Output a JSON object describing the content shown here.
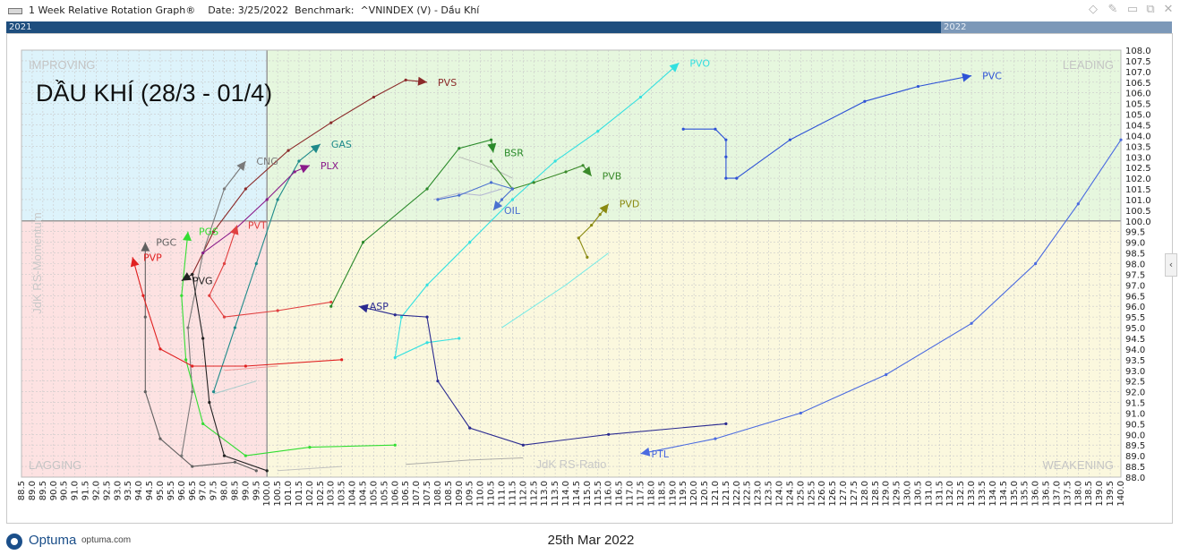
{
  "window": {
    "title": "1 Week Relative Rotation Graph®    Date: 3/25/2022  Benchmark:  ^VNINDEX (V) - Dầu Khí",
    "controls": [
      "◇",
      "✎",
      "▭",
      "⧉",
      "✕"
    ]
  },
  "timeline": {
    "left_label": "2021",
    "right_label": "2022"
  },
  "footer": {
    "logo_text": "Optuma",
    "logo_url": "optuma.com",
    "date": "25th Mar 2022"
  },
  "colors": {
    "improving": "#ddf3fb",
    "leading": "#e6f7de",
    "lagging": "#fde2e2",
    "weakening": "#fbf8de",
    "grid": "#c9c9c9",
    "axis": "#9a9a9a"
  },
  "chart_data": {
    "type": "scatter",
    "title": "DẦU KHÍ (28/3 - 01/4)",
    "xlabel": "JdK RS-Ratio",
    "ylabel": "JdK RS-Momentum",
    "xlim": [
      88.5,
      140.0
    ],
    "ylim": [
      88.0,
      108.0
    ],
    "x_ticks": [
      "88.5",
      "89.0",
      "89.5",
      "90.0",
      "90.5",
      "91.0",
      "91.5",
      "92.0",
      "92.5",
      "93.0",
      "93.5",
      "94.0",
      "94.5",
      "95.0",
      "95.5",
      "96.0",
      "96.5",
      "97.0",
      "97.5",
      "98.0",
      "98.5",
      "99.0",
      "99.5",
      "100.0",
      "100.5",
      "101.0",
      "101.5",
      "102.0",
      "102.5",
      "103.0",
      "103.5",
      "104.0",
      "104.5",
      "105.0",
      "105.5",
      "106.0",
      "106.5",
      "107.0",
      "107.5",
      "108.0",
      "108.5",
      "109.0",
      "109.5",
      "110.0",
      "110.5",
      "111.0",
      "111.5",
      "112.0",
      "112.5",
      "113.0",
      "113.5",
      "114.0",
      "114.5",
      "115.0",
      "115.5",
      "116.0",
      "116.5",
      "117.0",
      "117.5",
      "118.0",
      "118.5",
      "119.0",
      "119.5",
      "120.0",
      "120.5",
      "121.0",
      "121.5",
      "122.0",
      "122.5",
      "123.0",
      "123.5",
      "124.0",
      "124.5",
      "125.0",
      "125.5",
      "126.0",
      "126.5",
      "127.0",
      "127.5",
      "128.0",
      "128.5",
      "129.0",
      "129.5",
      "130.0",
      "130.5",
      "131.0",
      "131.5",
      "132.0",
      "132.5",
      "133.0",
      "133.5",
      "134.0",
      "134.5",
      "135.0",
      "135.5",
      "136.0",
      "136.5",
      "137.0",
      "137.5",
      "138.0",
      "138.5",
      "139.0",
      "139.5",
      "140.0"
    ],
    "y_ticks": [
      "108.0",
      "107.5",
      "107.0",
      "106.5",
      "106.0",
      "105.5",
      "105.0",
      "104.5",
      "104.0",
      "103.5",
      "103.0",
      "102.5",
      "102.0",
      "101.5",
      "101.0",
      "100.5",
      "100.0",
      "99.5",
      "99.0",
      "98.5",
      "98.0",
      "97.5",
      "97.0",
      "96.5",
      "96.0",
      "95.5",
      "95.0",
      "94.5",
      "94.0",
      "93.5",
      "93.0",
      "92.5",
      "92.0",
      "91.5",
      "91.0",
      "90.5",
      "90.0",
      "89.5",
      "89.0",
      "88.5",
      "88.0"
    ],
    "quadrants": {
      "improving": "IMPROVING",
      "leading": "LEADING",
      "lagging": "LAGGING",
      "weakening": "WEAKENING"
    },
    "grid": true,
    "series": [
      {
        "name": "PVS",
        "color": "#8b2a2a",
        "points": [
          [
            96.5,
            97.5
          ],
          [
            97.5,
            99.5
          ],
          [
            99.0,
            101.5
          ],
          [
            101.0,
            103.3
          ],
          [
            103.0,
            104.6
          ],
          [
            105.0,
            105.8
          ],
          [
            106.5,
            106.6
          ],
          [
            107.5,
            106.5
          ]
        ]
      },
      {
        "name": "PVO",
        "color": "#33e0e0",
        "points": [
          [
            109.0,
            94.5
          ],
          [
            107.5,
            94.3
          ],
          [
            106.0,
            93.6
          ],
          [
            106.3,
            95.5
          ],
          [
            107.5,
            97.0
          ],
          [
            109.5,
            99.0
          ],
          [
            111.5,
            101.0
          ],
          [
            113.5,
            102.8
          ],
          [
            115.5,
            104.2
          ],
          [
            117.5,
            105.8
          ],
          [
            119.3,
            107.4
          ]
        ]
      },
      {
        "name": "PVC",
        "color": "#2e52d6",
        "points": [
          [
            119.5,
            104.3
          ],
          [
            121.0,
            104.3
          ],
          [
            121.5,
            103.8
          ],
          [
            121.5,
            103.0
          ],
          [
            121.5,
            102.0
          ],
          [
            122.0,
            102.0
          ],
          [
            124.5,
            103.8
          ],
          [
            128.0,
            105.6
          ],
          [
            130.5,
            106.3
          ],
          [
            133.0,
            106.8
          ]
        ]
      },
      {
        "name": "GAS",
        "color": "#1e8a8a",
        "points": [
          [
            97.5,
            92.0
          ],
          [
            98.5,
            95.0
          ],
          [
            99.5,
            98.0
          ],
          [
            100.5,
            101.0
          ],
          [
            101.5,
            102.8
          ],
          [
            102.5,
            103.6
          ]
        ]
      },
      {
        "name": "BSR",
        "color": "#2a8a2a",
        "points": [
          [
            103.0,
            96.0
          ],
          [
            104.5,
            99.0
          ],
          [
            107.5,
            101.5
          ],
          [
            109.0,
            103.4
          ],
          [
            110.5,
            103.8
          ],
          [
            110.6,
            103.2
          ]
        ]
      },
      {
        "name": "CNG",
        "color": "#7a7a7a",
        "points": [
          [
            96.0,
            89.0
          ],
          [
            96.5,
            92.0
          ],
          [
            96.3,
            95.0
          ],
          [
            97.0,
            98.5
          ],
          [
            98.0,
            101.5
          ],
          [
            99.0,
            102.8
          ]
        ]
      },
      {
        "name": "PLX",
        "color": "#8a1a8a",
        "points": [
          [
            97.0,
            98.5
          ],
          [
            98.5,
            99.6
          ],
          [
            100.0,
            101.0
          ],
          [
            101.3,
            102.3
          ],
          [
            102.0,
            102.6
          ]
        ]
      },
      {
        "name": "PVB",
        "color": "#3a8a2a",
        "points": [
          [
            110.5,
            102.8
          ],
          [
            111.5,
            101.5
          ],
          [
            112.5,
            101.8
          ],
          [
            114.0,
            102.3
          ],
          [
            114.8,
            102.6
          ],
          [
            115.2,
            102.1
          ]
        ]
      },
      {
        "name": "OIL",
        "color": "#4a70d0",
        "points": [
          [
            108.0,
            101.0
          ],
          [
            109.0,
            101.2
          ],
          [
            110.5,
            101.8
          ],
          [
            111.5,
            101.5
          ],
          [
            111.0,
            101.0
          ],
          [
            110.6,
            100.5
          ]
        ]
      },
      {
        "name": "PVD",
        "color": "#8a8a10",
        "points": [
          [
            115.0,
            98.3
          ],
          [
            114.6,
            99.2
          ],
          [
            115.2,
            99.8
          ],
          [
            115.6,
            100.3
          ],
          [
            116.0,
            100.8
          ]
        ]
      },
      {
        "name": "PVT",
        "color": "#e04040",
        "points": [
          [
            103.0,
            96.2
          ],
          [
            100.5,
            95.8
          ],
          [
            98.0,
            95.5
          ],
          [
            97.3,
            96.5
          ],
          [
            98.0,
            98.0
          ],
          [
            98.6,
            99.8
          ]
        ]
      },
      {
        "name": "PGS",
        "color": "#33dd33",
        "points": [
          [
            106.0,
            89.5
          ],
          [
            102.0,
            89.4
          ],
          [
            99.0,
            89.0
          ],
          [
            97.0,
            90.5
          ],
          [
            96.2,
            93.5
          ],
          [
            96.0,
            96.5
          ],
          [
            96.3,
            99.5
          ]
        ]
      },
      {
        "name": "PGC",
        "color": "#606060",
        "points": [
          [
            99.5,
            88.3
          ],
          [
            98.5,
            88.7
          ],
          [
            96.5,
            88.5
          ],
          [
            95.0,
            89.8
          ],
          [
            94.3,
            92.0
          ],
          [
            94.3,
            95.5
          ],
          [
            94.3,
            99.0
          ]
        ]
      },
      {
        "name": "PVP",
        "color": "#e02020",
        "points": [
          [
            103.5,
            93.5
          ],
          [
            99.0,
            93.2
          ],
          [
            96.5,
            93.2
          ],
          [
            95.0,
            94.0
          ],
          [
            94.2,
            96.5
          ],
          [
            93.7,
            98.3
          ]
        ]
      },
      {
        "name": "PVG",
        "color": "#222222",
        "points": [
          [
            100.0,
            88.3
          ],
          [
            98.0,
            89.0
          ],
          [
            97.3,
            91.5
          ],
          [
            97.0,
            94.5
          ],
          [
            96.5,
            97.5
          ],
          [
            96.0,
            97.2
          ]
        ]
      },
      {
        "name": "ASP",
        "color": "#2a2a90",
        "points": [
          [
            121.5,
            90.5
          ],
          [
            116.0,
            90.0
          ],
          [
            112.0,
            89.5
          ],
          [
            109.5,
            90.3
          ],
          [
            108.0,
            92.5
          ],
          [
            107.5,
            95.5
          ],
          [
            106.0,
            95.6
          ],
          [
            104.3,
            96.0
          ]
        ]
      },
      {
        "name": "PTL",
        "color": "#4a6ae0",
        "points": [
          [
            140.0,
            103.8
          ],
          [
            138.0,
            100.8
          ],
          [
            136.0,
            98.0
          ],
          [
            133.0,
            95.2
          ],
          [
            129.0,
            92.8
          ],
          [
            125.0,
            91.0
          ],
          [
            121.0,
            89.8
          ],
          [
            117.5,
            89.1
          ]
        ]
      }
    ],
    "ghost_lines": [
      {
        "color": "#a8a8d0",
        "points": [
          [
            107.8,
            101.0
          ],
          [
            109.0,
            101.3
          ],
          [
            110.0,
            101.2
          ],
          [
            111.0,
            101.5
          ]
        ]
      },
      {
        "color": "#b0b0b0",
        "points": [
          [
            109.0,
            103.0
          ],
          [
            110.5,
            102.5
          ],
          [
            111.5,
            102.0
          ]
        ]
      },
      {
        "color": "#a0a0a0",
        "points": [
          [
            106.5,
            88.6
          ],
          [
            109.5,
            88.8
          ],
          [
            112.0,
            88.9
          ]
        ]
      },
      {
        "color": "#b8b8b8",
        "points": [
          [
            103.5,
            88.5
          ],
          [
            100.5,
            88.3
          ]
        ]
      },
      {
        "color": "#f09090",
        "points": [
          [
            98.0,
            93.0
          ],
          [
            100.5,
            93.2
          ]
        ]
      },
      {
        "color": "#98c8c8",
        "points": [
          [
            97.5,
            91.9
          ],
          [
            99.5,
            92.5
          ]
        ]
      },
      {
        "color": "#5ae8e8",
        "points": [
          [
            116.0,
            98.5
          ],
          [
            114.0,
            97.0
          ],
          [
            111.0,
            95.0
          ]
        ]
      }
    ]
  }
}
